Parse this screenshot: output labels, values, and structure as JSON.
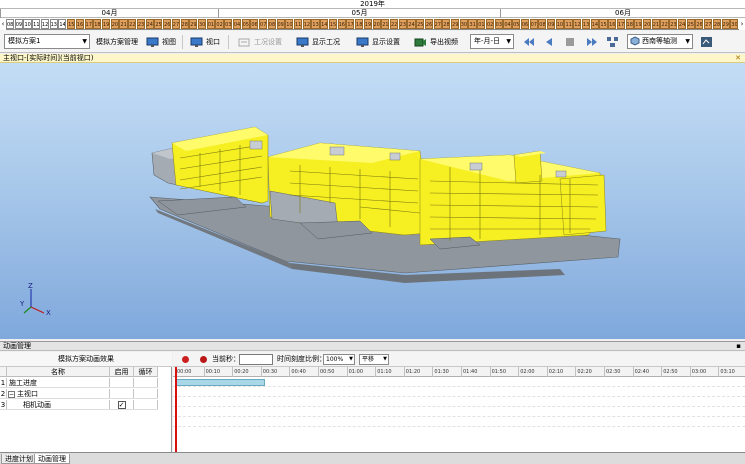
{
  "calendar": {
    "year": "2019年",
    "months": [
      "04月",
      "05月",
      "06月"
    ],
    "days": [
      "08",
      "09",
      "10",
      "11",
      "12",
      "13",
      "14",
      "15",
      "16",
      "17",
      "18",
      "19",
      "20",
      "21",
      "22",
      "23",
      "24",
      "25",
      "26",
      "27",
      "28",
      "29",
      "30",
      "01",
      "02",
      "03",
      "04",
      "05",
      "06",
      "07",
      "08",
      "09",
      "10",
      "11",
      "12",
      "13",
      "14",
      "15",
      "16",
      "17",
      "18",
      "19",
      "20",
      "21",
      "22",
      "23",
      "24",
      "25",
      "26",
      "27",
      "28",
      "29",
      "30",
      "31",
      "01",
      "02",
      "03",
      "04",
      "05",
      "06",
      "07",
      "08",
      "09",
      "10",
      "11",
      "12",
      "13",
      "14",
      "15",
      "16",
      "17",
      "18",
      "19",
      "20",
      "21",
      "22",
      "23",
      "24",
      "25",
      "26",
      "27",
      "28",
      "29",
      "30"
    ]
  },
  "toolbar": {
    "scheme_select": "模拟方案1",
    "scheme_manage": "模拟方案管理",
    "view": "视图",
    "viewport": "视口",
    "work_settings": "工况设置",
    "show_work": "显示工况",
    "display_settings": "显示设置",
    "export_video": "导出视频",
    "date_format": "年-月-日",
    "camera_view": "西南等轴测"
  },
  "viewport": {
    "title": "主视口-[实际时间](当前视口)"
  },
  "animation": {
    "panel_title": "动画管理",
    "effect_title": "模拟方案动画效果",
    "columns": [
      "名称",
      "启用",
      "循环"
    ],
    "rows": [
      {
        "num": "1",
        "name": "施工进度",
        "toggle": "",
        "enabled": "",
        "loop": ""
      },
      {
        "num": "2",
        "name": "主视口",
        "toggle": "−",
        "enabled": "",
        "loop": ""
      },
      {
        "num": "3",
        "name": "相机动画",
        "toggle": "",
        "enabled": "✓",
        "loop": ""
      }
    ],
    "current_second_label": "当前秒：",
    "current_second_value": "",
    "scale_label": "时间刻度比例：",
    "scale_value": "100%",
    "mode_value": "平移",
    "ticks": [
      "00:00",
      "00:10",
      "00:20",
      "00:30",
      "00:40",
      "00:50",
      "01:00",
      "01:10",
      "01:20",
      "01:30",
      "01:40",
      "01:50",
      "02:00",
      "02:10",
      "02:20",
      "02:30",
      "02:40",
      "02:50",
      "03:00",
      "03:10",
      "03:20"
    ],
    "bar_end_fraction": 0.155
  },
  "bottom_tabs": [
    "进度计划",
    "动画管理"
  ],
  "axis_labels": {
    "z": "Z",
    "y": "Y",
    "x": "X"
  },
  "colors": {
    "building_yellow": "#f6ef22",
    "building_grey": "#9fa5ad",
    "accent_red": "#d81010",
    "calendar_orange": "#e0a060"
  }
}
